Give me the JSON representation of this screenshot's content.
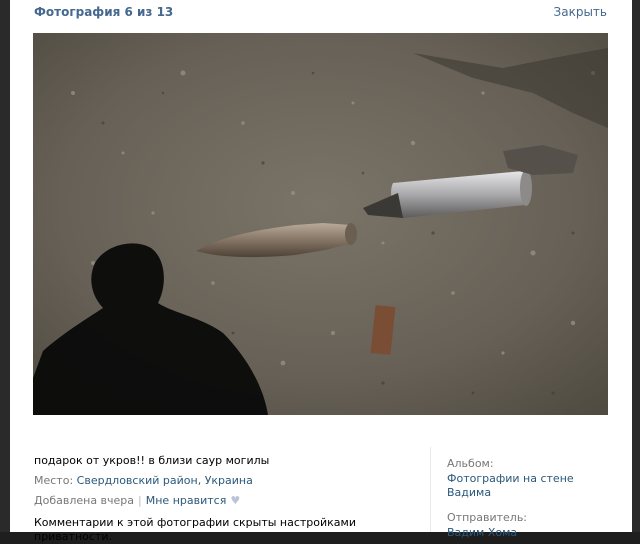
{
  "header": {
    "counter": "Фотография 6 из 13",
    "close_label": "Закрыть"
  },
  "photo": {
    "subject": "artillery-shell-photo"
  },
  "info": {
    "caption": "подарок от укров!! в близи саур могилы",
    "location_label": "Место:",
    "location_value": "Свердловский район, Украина",
    "added": "Добавлена вчера",
    "separator": "|",
    "like_label": "Мне нравится",
    "like_icon": "heart-icon",
    "privacy": "Комментарии к этой фотографии скрыты настройками приватности."
  },
  "sidebar": {
    "album_label": "Альбом:",
    "album_value": "Фотографии на стене Вадима",
    "sender_label": "Отправитель:",
    "sender_value": "Вадим Хома"
  },
  "colors": {
    "link": "#2b587a",
    "header_link": "#45688e",
    "backdrop": "#1e1e1e"
  }
}
